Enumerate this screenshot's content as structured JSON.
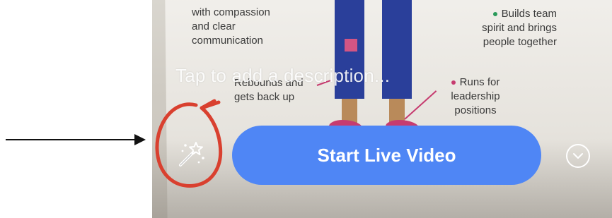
{
  "poster": {
    "left_text": "with compassion\nand clear\ncommunication",
    "right_text": "Builds team\nspirit and brings\npeople together",
    "mid_text": "Rebounds and\ngets back up",
    "runs_text": "Runs for\nleadership\npositions"
  },
  "description_placeholder": "Tap to add a description...",
  "start_button_label": "Start Live Video",
  "icons": {
    "magic": "magic-wand-sparkles-icon",
    "more": "chevron-down-circle-icon",
    "annotation_arrow": "arrow-right-icon"
  },
  "colors": {
    "primary_button": "#4f86f5",
    "annotation_circle": "#d9402f"
  }
}
